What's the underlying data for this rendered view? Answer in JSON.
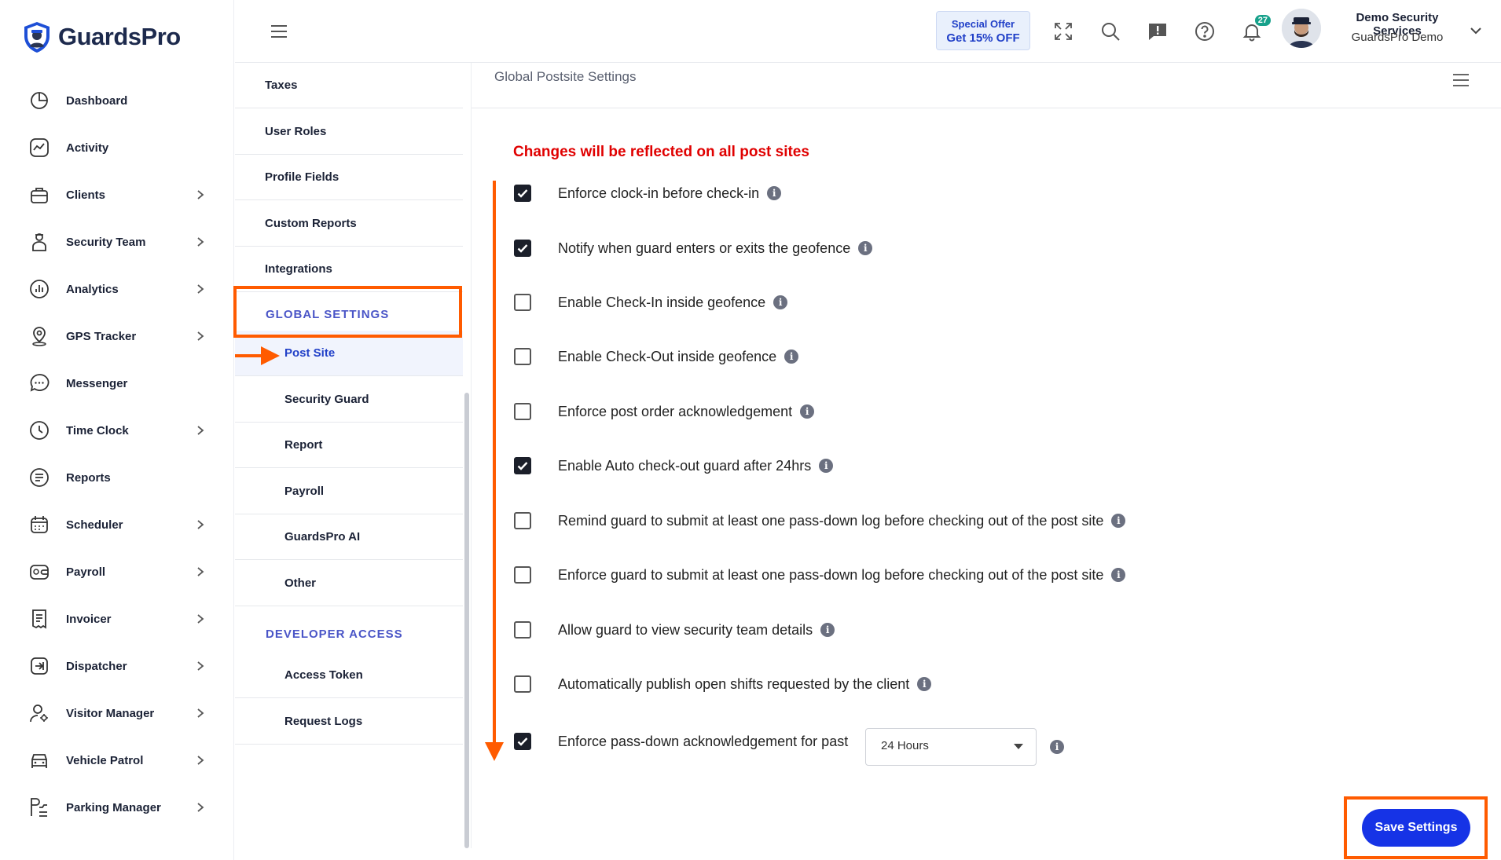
{
  "app": {
    "logo_text": "GuardsPro"
  },
  "sidebar": {
    "items": [
      {
        "label": "Dashboard",
        "icon": "dashboard-icon",
        "has_children": false
      },
      {
        "label": "Activity",
        "icon": "activity-icon",
        "has_children": false
      },
      {
        "label": "Clients",
        "icon": "clients-icon",
        "has_children": true
      },
      {
        "label": "Security Team",
        "icon": "security-team-icon",
        "has_children": true
      },
      {
        "label": "Analytics",
        "icon": "analytics-icon",
        "has_children": true
      },
      {
        "label": "GPS Tracker",
        "icon": "gps-icon",
        "has_children": true
      },
      {
        "label": "Messenger",
        "icon": "messenger-icon",
        "has_children": false
      },
      {
        "label": "Time Clock",
        "icon": "clock-icon",
        "has_children": true
      },
      {
        "label": "Reports",
        "icon": "reports-icon",
        "has_children": false
      },
      {
        "label": "Scheduler",
        "icon": "calendar-icon",
        "has_children": true
      },
      {
        "label": "Payroll",
        "icon": "wallet-icon",
        "has_children": true
      },
      {
        "label": "Invoicer",
        "icon": "invoice-icon",
        "has_children": true
      },
      {
        "label": "Dispatcher",
        "icon": "dispatch-icon",
        "has_children": true
      },
      {
        "label": "Visitor Manager",
        "icon": "visitor-icon",
        "has_children": true
      },
      {
        "label": "Vehicle Patrol",
        "icon": "car-icon",
        "has_children": true
      },
      {
        "label": "Parking Manager",
        "icon": "parking-icon",
        "has_children": true
      }
    ]
  },
  "topbar": {
    "offer_line1": "Special Offer",
    "offer_line2": "Get 15% OFF",
    "notification_count": "27",
    "user_name": "Demo Security Services",
    "user_company": "GuardsPro Demo"
  },
  "submenu": {
    "items_top": [
      "Taxes",
      "User Roles",
      "Profile Fields",
      "Custom Reports",
      "Integrations"
    ],
    "global_heading": "GLOBAL SETTINGS",
    "global_items": [
      "Post Site",
      "Security Guard",
      "Report",
      "Payroll",
      "GuardsPro AI",
      "Other"
    ],
    "active_item": "Post Site",
    "developer_heading": "DEVELOPER ACCESS",
    "developer_items": [
      "Access Token",
      "Request Logs"
    ]
  },
  "panel": {
    "title": "Global Postsite Settings",
    "warning": "Changes will be reflected on all post sites",
    "options": [
      {
        "label": "Enforce clock-in before check-in",
        "checked": true
      },
      {
        "label": "Notify when guard enters or exits the geofence",
        "checked": true
      },
      {
        "label": "Enable Check-In inside geofence",
        "checked": false
      },
      {
        "label": "Enable Check-Out inside geofence",
        "checked": false
      },
      {
        "label": "Enforce post order acknowledgement",
        "checked": false
      },
      {
        "label": "Enable Auto check-out guard after 24hrs",
        "checked": true
      },
      {
        "label": "Remind guard to submit at least one pass-down log before checking out of the post site",
        "checked": false
      },
      {
        "label": "Enforce guard to submit at least one pass-down log before checking out of the post site",
        "checked": false
      },
      {
        "label": "Allow guard to view security team details",
        "checked": false
      },
      {
        "label": "Automatically publish open shifts requested by the client",
        "checked": false
      },
      {
        "label": "Enforce pass-down acknowledgement for past",
        "checked": true
      }
    ],
    "passdown_select_value": "24 Hours",
    "save_label": "Save Settings"
  },
  "colors": {
    "accent": "#1633e6",
    "annotation": "#ff5b00",
    "warning": "#e00000",
    "heading": "#4a55c7"
  }
}
